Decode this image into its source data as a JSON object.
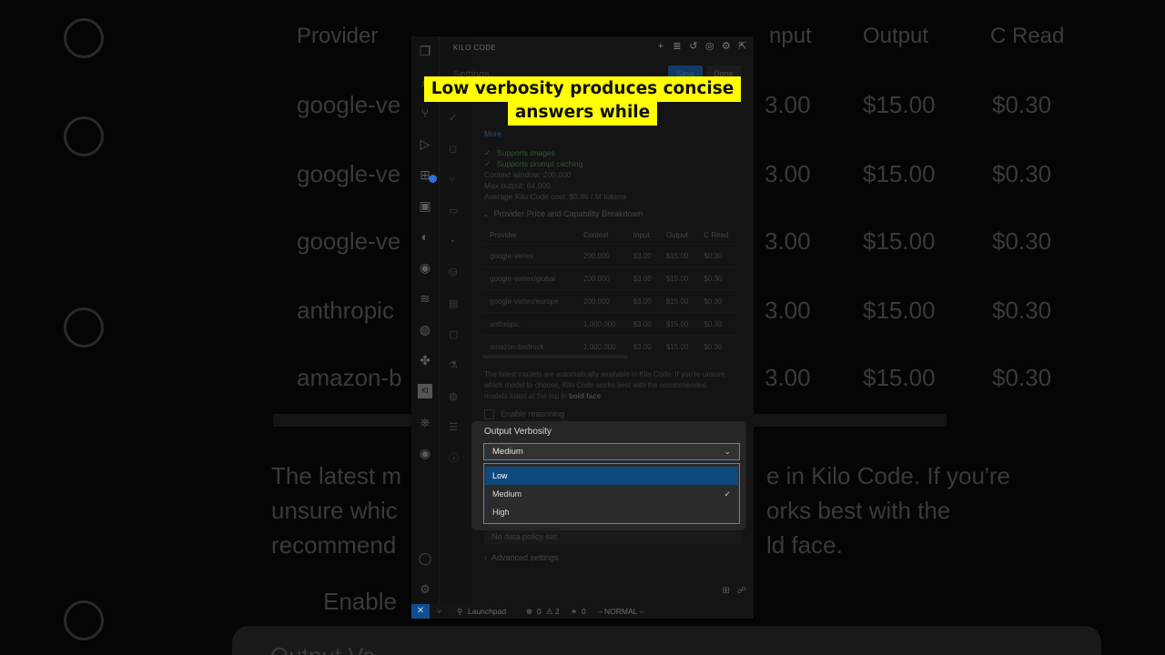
{
  "caption": {
    "line1": "Low verbosity produces concise",
    "line2": "answers while"
  },
  "background": {
    "header_provider": "Provider",
    "header_input": "nput",
    "header_output": "Output",
    "header_cread": "C Read",
    "rows": [
      {
        "name": "google-ve",
        "input": "3.00",
        "output": "$15.00",
        "cread": "$0.30"
      },
      {
        "name": "google-ve",
        "input": "3.00",
        "output": "$15.00",
        "cread": "$0.30"
      },
      {
        "name": "google-ve",
        "input": "3.00",
        "output": "$15.00",
        "cread": "$0.30"
      },
      {
        "name": "anthropic",
        "input": "3.00",
        "output": "$15.00",
        "cread": "$0.30"
      },
      {
        "name": "amazon-b",
        "input": "3.00",
        "output": "$15.00",
        "cread": "$0.30"
      }
    ],
    "para_left1": "The latest m",
    "para_right1": "e in Kilo Code. If you're",
    "para_left2": "unsure whic",
    "para_right2": "orks best with the",
    "para_left3": "recommend",
    "para_right3": "ld face.",
    "enable": "Enable",
    "output_v": "Output Ve"
  },
  "window": {
    "title": "KILO CODE",
    "settings_title": "Settings",
    "save": "Save",
    "done": "Done",
    "more": "More",
    "supports_images": "Supports images",
    "supports_caching": "Supports prompt caching",
    "context_window": "Context window: 200,000",
    "max_output": "Max output: 64,000",
    "avg_cost": "Average Kilo Code cost: $0.86 / M tokens",
    "breakdown": "Provider Price and Capability Breakdown",
    "table": {
      "headers": [
        "Provider",
        "Context",
        "Input",
        "Output",
        "C Read"
      ],
      "rows": [
        [
          "google-vertex",
          "200,000",
          "$3.00",
          "$15.00",
          "$0.30"
        ],
        [
          "google-vertex/global",
          "200,000",
          "$3.00",
          "$15.00",
          "$0.30"
        ],
        [
          "google-vertex/europe",
          "200,000",
          "$3.00",
          "$15.00",
          "$0.30"
        ],
        [
          "anthropic",
          "1,000,000",
          "$3.00",
          "$15.00",
          "$0.30"
        ],
        [
          "amazon-bedrock",
          "1,000,000",
          "$3.00",
          "$15.00",
          "$0.30"
        ]
      ]
    },
    "para_a": "The latest models are automatically available in Kilo Code. If you're unsure which model to choose, Kilo Code works best with the recommended models listed at the top in ",
    "para_bold": "bold face",
    "para_end": ".",
    "enable_reasoning": "Enable reasoning",
    "data_policy": "No data policy set",
    "advanced": "Advanced settings",
    "status": {
      "launchpad": "Launchpad",
      "errors": "0",
      "warnings": "2",
      "ports": "0",
      "mode": "-- NORMAL --"
    }
  },
  "verbosity": {
    "label": "Output Verbosity",
    "selected": "Medium",
    "options": [
      "Low",
      "Medium",
      "High"
    ]
  },
  "colors": {
    "caption_bg": "#ffff00",
    "accent": "#3b8ede",
    "highlight": "#0e4a7c"
  }
}
